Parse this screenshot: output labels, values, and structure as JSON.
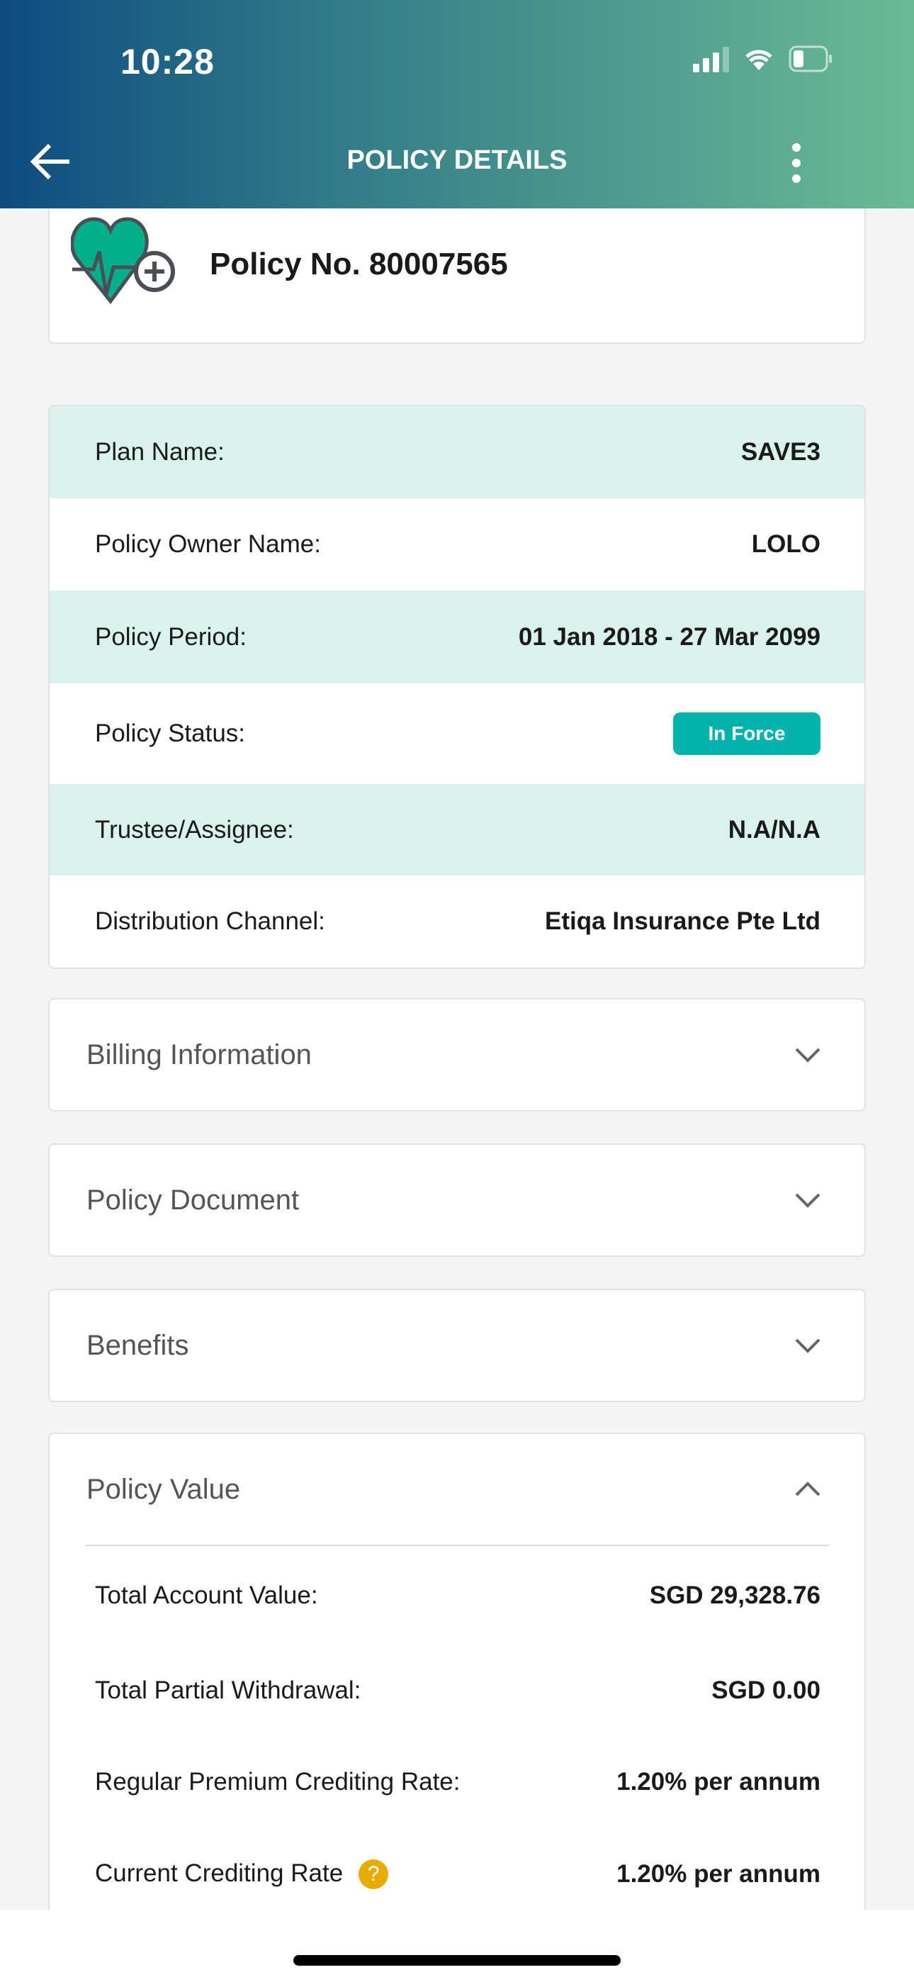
{
  "status_bar": {
    "time": "10:28"
  },
  "nav": {
    "title": "POLICY DETAILS",
    "back_icon": "arrow-left-icon",
    "menu_icon": "more-vertical-icon"
  },
  "policy": {
    "number_label": "Policy No. 80007565",
    "icon": "heart-plus-icon"
  },
  "details": [
    {
      "label": "Plan Name:",
      "value": "SAVE3"
    },
    {
      "label": "Policy Owner Name:",
      "value": "LOLO"
    },
    {
      "label": "Policy Period:",
      "value": "01 Jan 2018 - 27 Mar 2099"
    },
    {
      "label": "Policy Status:",
      "value": "In Force"
    },
    {
      "label": "Trustee/Assignee:",
      "value": "N.A/N.A"
    },
    {
      "label": "Distribution Channel:",
      "value": "Etiqa Insurance Pte Ltd"
    }
  ],
  "accordions": [
    {
      "title": "Billing Information"
    },
    {
      "title": "Policy Document"
    },
    {
      "title": "Benefits"
    },
    {
      "title": "Policy Value"
    }
  ],
  "policy_value": [
    {
      "label": "Total Account Value:",
      "value": "SGD 29,328.76"
    },
    {
      "label": "Total Partial Withdrawal:",
      "value": "SGD 0.00"
    },
    {
      "label": "Regular Premium Crediting Rate:",
      "value": "1.20% per annum"
    },
    {
      "label": "Current Crediting Rate",
      "value": "1.20% per annum",
      "help": "?"
    }
  ],
  "colors": {
    "status_badge": "#00b3ac",
    "row_alt": "#d9f3ec",
    "help": "#e8ac00"
  }
}
